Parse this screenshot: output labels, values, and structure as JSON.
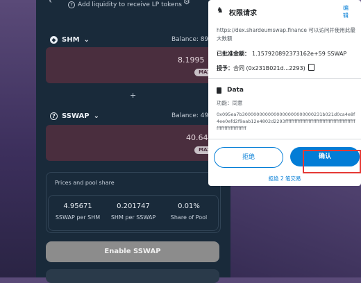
{
  "topbar": {
    "hint": "Add liquidity to receive LP tokens"
  },
  "token_a": {
    "symbol": "SHM",
    "balance": "Balance: 89.",
    "amount": "8.1995",
    "max": "MAX"
  },
  "plus": "+",
  "token_b": {
    "symbol": "SSWAP",
    "balance": "Balance: 49.",
    "amount": "40.64",
    "max": "MAX"
  },
  "pool_share": {
    "title": "Prices and pool share",
    "cols": [
      {
        "value": "4.95671",
        "label": "SSWAP per SHM"
      },
      {
        "value": "0.201747",
        "label": "SHM per SSWAP"
      },
      {
        "value": "0.01%",
        "label": "Share of Pool"
      }
    ]
  },
  "enable_button": "Enable SSWAP",
  "popup": {
    "title": "权限请求",
    "edit": "编辑",
    "site_text": "https://dex.shardeumswap.finance 可以访问并使用此最大数额",
    "approved_label": "已批准金额：",
    "approved_value": "1.157920892373162e+59 SSWAP",
    "granted_label": "授予：",
    "granted_value": "合同 (0x231B021d...2293)",
    "data_label": "Data",
    "function_label": "功能：同意",
    "hex": "0x095ea7b3000000000000000000000000231b021d0ca4e8f4ee0efd2f9aab12e4802d2293ffffffffffffffffffffffffffffffffffffffffffffffffffffffffffffffff",
    "reject_button": "拒绝",
    "confirm_button": "确认",
    "reject_link": "拒绝 2 笔交易"
  },
  "colors": {
    "accent": "#037dd6",
    "panel": "#192a3a",
    "highlight": "#e53935"
  }
}
